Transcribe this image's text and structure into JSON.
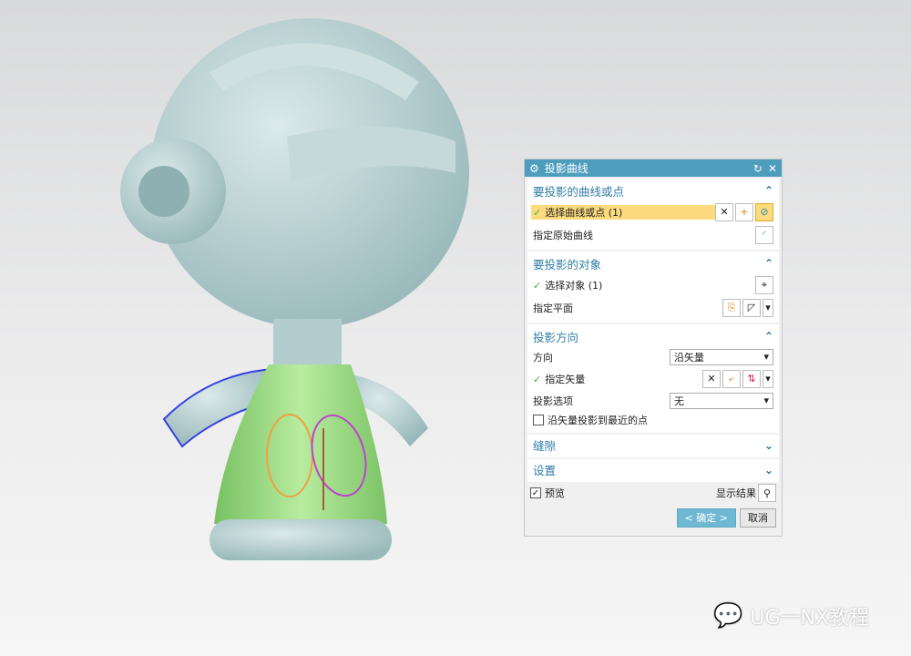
{
  "dialog": {
    "title": "投影曲线",
    "sections": [
      {
        "title": "要投影的曲线或点",
        "rows": [
          "选择曲线或点 (1)",
          "指定原始曲线"
        ]
      },
      {
        "title": "要投影的对象",
        "rows": [
          "选择对象 (1)",
          "指定平面"
        ]
      },
      {
        "title": "投影方向",
        "direction_label": "方向",
        "direction_value": "沿矢量",
        "vector_label": "指定矢量",
        "option_label": "投影选项",
        "option_value": "无",
        "checkbox_label": "沿矢量投影到最近的点"
      },
      {
        "title": "缝隙"
      },
      {
        "title": "设置"
      }
    ],
    "preview_label": "预览",
    "show_result_label": "显示结果",
    "ok_label": "< 确定 >",
    "cancel_label": "取消"
  },
  "watermark": "UG一NX教程",
  "colors": {
    "title_bar": "#4f9dbd",
    "highlight": "#fbdb7d",
    "model_body": "#b7d1d2",
    "model_shirt": "#8fd57a"
  }
}
